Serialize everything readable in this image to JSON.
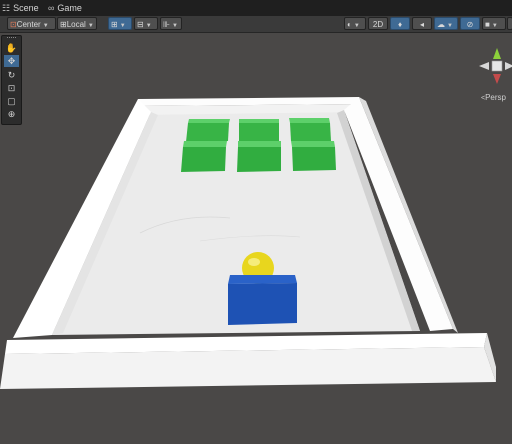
{
  "tabs": [
    {
      "label": "Scene",
      "icon": "hash-grid-icon"
    },
    {
      "label": "Game",
      "icon": "gamepad-icon"
    }
  ],
  "toolbar": {
    "pivot_label": "Center",
    "space_label": "Local",
    "mode_2d_label": "2D"
  },
  "scene_view": {
    "camera_label": "Persp",
    "colors": {
      "floor": "#eaeaea",
      "wall": "#ffffff",
      "brick": "#36b244",
      "paddle": "#1f55b8",
      "ball": "#e6d51c",
      "background": "#4a4847"
    }
  }
}
